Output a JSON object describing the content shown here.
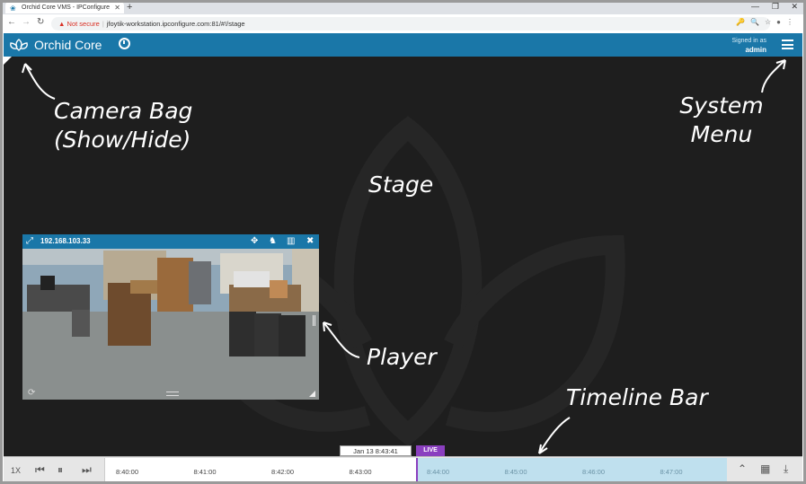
{
  "browser": {
    "tab_title": "Orchid Core VMS - IPConfigure",
    "security_label": "Not secure",
    "url": "jfoytik-workstation.ipconfigure.com:81/#!/stage"
  },
  "header": {
    "app_title": "Orchid Core",
    "signed_in_label": "Signed in as",
    "username": "admin",
    "brand_color": "#1a77a8"
  },
  "player": {
    "ip": "192.168.103.33"
  },
  "callouts": {
    "camera_bag": "Camera Bag\n(Show/Hide)",
    "system_menu": "System\nMenu",
    "stage": "Stage",
    "player": "Player",
    "timeline_bar": "Timeline Bar"
  },
  "timeline": {
    "speed": "1X",
    "current_time": "Jan 13 8:43:41",
    "live_label": "LIVE",
    "ticks": [
      "8:40:00",
      "8:41:00",
      "8:42:00",
      "8:43:00",
      "8:44:00",
      "8:45:00",
      "8:46:00",
      "8:47:00"
    ],
    "live_color": "#8a3fbf",
    "future_color": "#bfe0ee"
  }
}
